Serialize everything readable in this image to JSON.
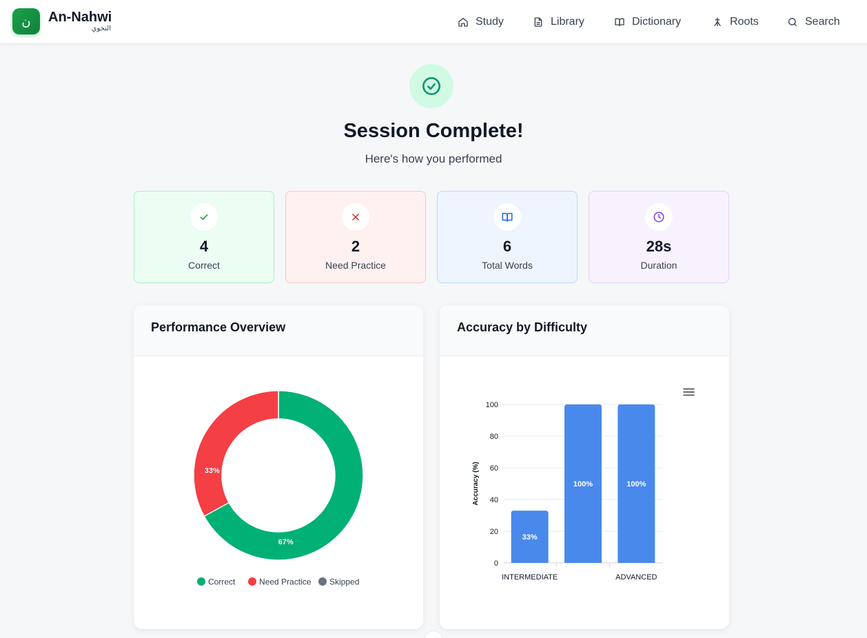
{
  "app": {
    "logo_glyph": "ن",
    "name": "An-Nahwi",
    "name_ar": "النحوي"
  },
  "nav": [
    {
      "label": "Study",
      "icon": "home-icon"
    },
    {
      "label": "Library",
      "icon": "document-icon"
    },
    {
      "label": "Dictionary",
      "icon": "book-icon"
    },
    {
      "label": "Roots",
      "icon": "roots-icon"
    },
    {
      "label": "Search",
      "icon": "search-icon"
    }
  ],
  "hero": {
    "title": "Session Complete!",
    "subtitle": "Here's how you performed",
    "icon": "check-circle-icon"
  },
  "stats": [
    {
      "value": "4",
      "label": "Correct",
      "icon": "check-icon",
      "color": "#16a34a",
      "bg": "#ecfdf3",
      "border": "#a7f3c6"
    },
    {
      "value": "2",
      "label": "Need Practice",
      "icon": "x-icon",
      "color": "#dc2626",
      "bg": "#fef1f0",
      "border": "#f7c7c2"
    },
    {
      "value": "6",
      "label": "Total Words",
      "icon": "book-open-icon",
      "color": "#2563eb",
      "bg": "#eef5ff",
      "border": "#bcd6fb"
    },
    {
      "value": "28s",
      "label": "Duration",
      "icon": "clock-icon",
      "color": "#7c3aed",
      "bg": "#f8f2ff",
      "border": "#e2d0fb"
    }
  ],
  "panels": {
    "performance_title": "Performance Overview",
    "accuracy_title": "Accuracy by Difficulty"
  },
  "chart_data": [
    {
      "type": "pie",
      "title": "Performance Overview",
      "categories": [
        "Correct",
        "Need Practice",
        "Skipped"
      ],
      "values": [
        67,
        33,
        0
      ],
      "labels": [
        "67%",
        "33%",
        ""
      ],
      "colors": [
        "#00b074",
        "#f43f45",
        "#6b7280"
      ],
      "donut": true,
      "legend": "bottom"
    },
    {
      "type": "bar",
      "title": "Accuracy by Difficulty",
      "categories": [
        "INTERMEDIATE",
        "",
        "ADVANCED"
      ],
      "values": [
        33,
        100,
        100
      ],
      "labels": [
        "33%",
        "100%",
        "100%"
      ],
      "ylabel": "Accuracy (%)",
      "ylim": [
        0,
        100
      ],
      "yticks": [
        0,
        20,
        40,
        60,
        80,
        100
      ],
      "color": "#4a89ec",
      "grid": true,
      "menu_icon": "hamburger-menu-icon"
    }
  ]
}
